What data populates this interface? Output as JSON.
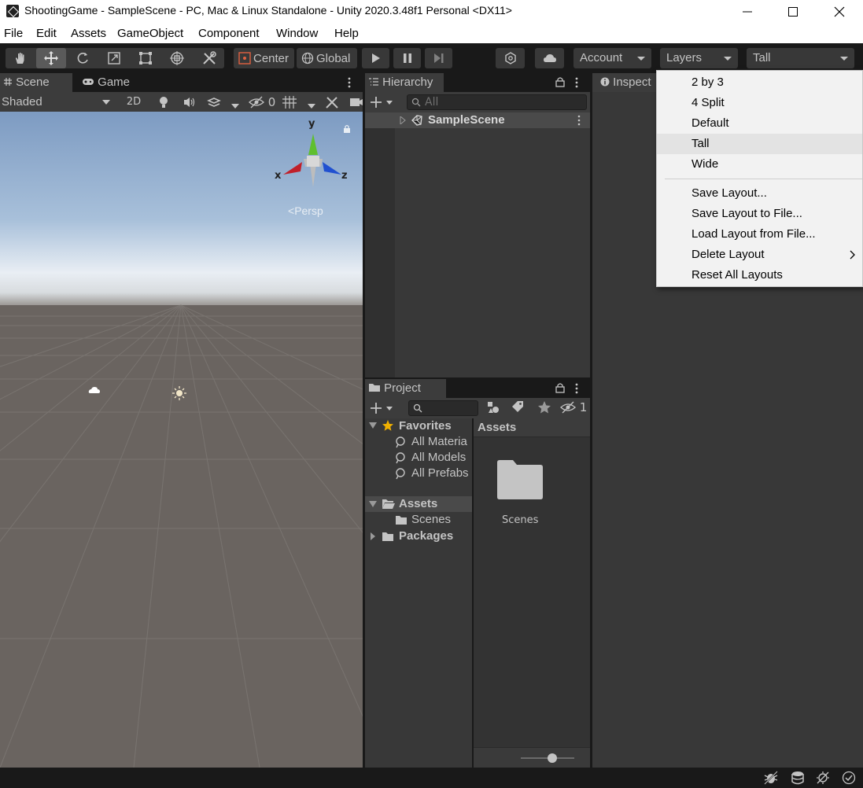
{
  "window": {
    "title": "ShootingGame - SampleScene - PC, Mac & Linux Standalone - Unity 2020.3.48f1 Personal <DX11>"
  },
  "menubar": [
    "File",
    "Edit",
    "Assets",
    "GameObject",
    "Component",
    "Window",
    "Help"
  ],
  "toolbar": {
    "pivot": "Center",
    "space": "Global",
    "account": "Account",
    "layers": "Layers",
    "layout": "Tall"
  },
  "scene_panel": {
    "tabs": [
      "Scene",
      "Game"
    ],
    "shading": "Shaded",
    "mode_2d": "2D",
    "hidden_count": "0",
    "gizmo_axes": {
      "y": "y",
      "x": "x",
      "z": "z"
    },
    "projection": "Persp"
  },
  "hierarchy": {
    "tab": "Hierarchy",
    "search_placeholder": "All",
    "scene": "SampleScene"
  },
  "inspector": {
    "tab": "Inspect"
  },
  "project": {
    "tab": "Project",
    "hidden_count": "1",
    "favorites_label": "Favorites",
    "favorites": [
      "All Materia",
      "All Models",
      "All Prefabs"
    ],
    "assets_label": "Assets",
    "assets_children": [
      "Scenes"
    ],
    "packages_label": "Packages",
    "breadcrumb": "Assets",
    "grid_items": [
      "Scenes"
    ]
  },
  "layout_menu": {
    "items": [
      "2 by 3",
      "4 Split",
      "Default",
      "Tall",
      "Wide"
    ],
    "selected": "Tall",
    "actions": [
      "Save Layout...",
      "Save Layout to File...",
      "Load Layout from File...",
      "Delete Layout",
      "Reset All Layouts"
    ]
  },
  "colors": {
    "editor_bg": "#383838",
    "panel_header": "#3c3c3c",
    "sky_top": "#8aa8cc",
    "ground": "#6b6561",
    "gizmo_y": "#5fbf2f",
    "gizmo_x": "#c0202a",
    "gizmo_z": "#2050d0"
  }
}
